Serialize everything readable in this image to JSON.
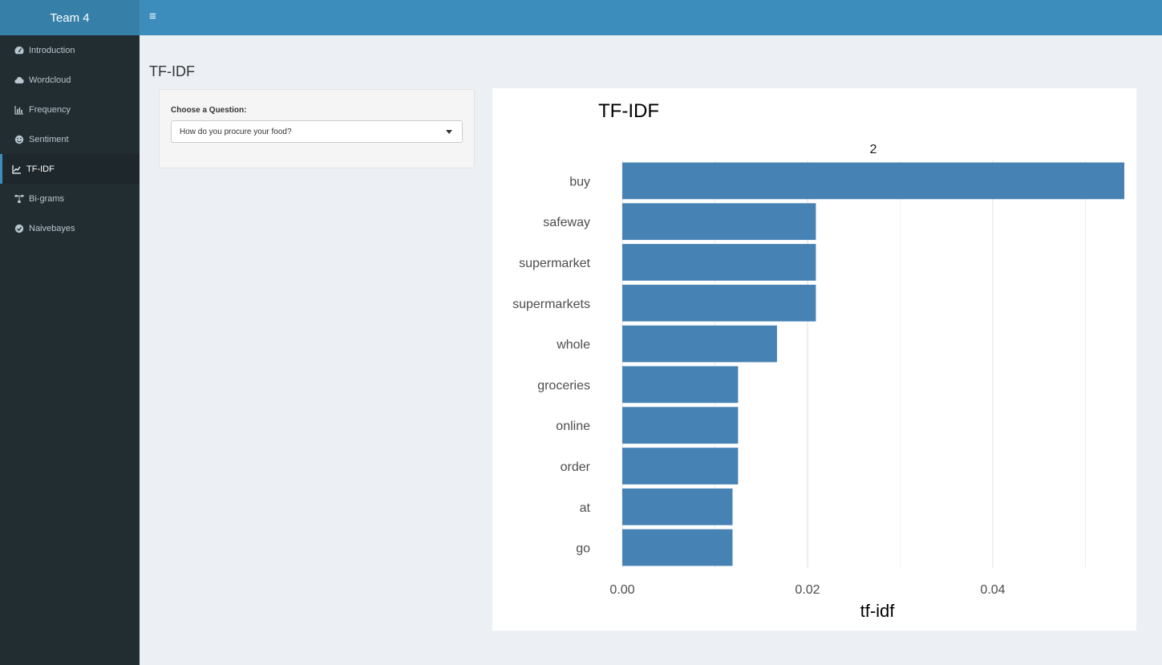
{
  "header": {
    "brand": "Team 4",
    "toggle_icon": "hamburger-icon"
  },
  "sidebar": {
    "items": [
      {
        "label": "Introduction",
        "icon": "dashboard-icon",
        "active": false
      },
      {
        "label": "Wordcloud",
        "icon": "cloud-icon",
        "active": false
      },
      {
        "label": "Frequency",
        "icon": "bar-chart-icon",
        "active": false
      },
      {
        "label": "Sentiment",
        "icon": "smile-icon",
        "active": false
      },
      {
        "label": "TF-IDF",
        "icon": "line-chart-icon",
        "active": true
      },
      {
        "label": "Bi-grams",
        "icon": "sitemap-icon",
        "active": false
      },
      {
        "label": "Naivebayes",
        "icon": "check-circle-icon",
        "active": false
      }
    ]
  },
  "main": {
    "title": "TF-IDF",
    "control": {
      "label": "Choose a Question:",
      "selected": "How do you procure your food?"
    }
  },
  "colors": {
    "header": "#3c8dbc",
    "logo": "#367fa9",
    "sidebar": "#222d32",
    "sidebar_active": "#1e282c",
    "bar": "#4682b4",
    "background": "#ecf0f5"
  },
  "chart_data": {
    "type": "bar",
    "orientation": "horizontal",
    "title": "TF-IDF",
    "facet_label": "2",
    "xlabel": "tf-idf",
    "ylabel": "",
    "categories": [
      "buy",
      "safeway",
      "supermarket",
      "supermarkets",
      "whole",
      "groceries",
      "online",
      "order",
      "at",
      "go"
    ],
    "values": [
      0.0542,
      0.0209,
      0.0209,
      0.0209,
      0.0167,
      0.0125,
      0.0125,
      0.0125,
      0.0119,
      0.0119
    ],
    "xlim": [
      0,
      0.0542
    ],
    "x_ticks": [
      "0.00",
      "0.02",
      "0.04"
    ],
    "x_tick_values": [
      0,
      0.02,
      0.04
    ],
    "grid": true
  }
}
